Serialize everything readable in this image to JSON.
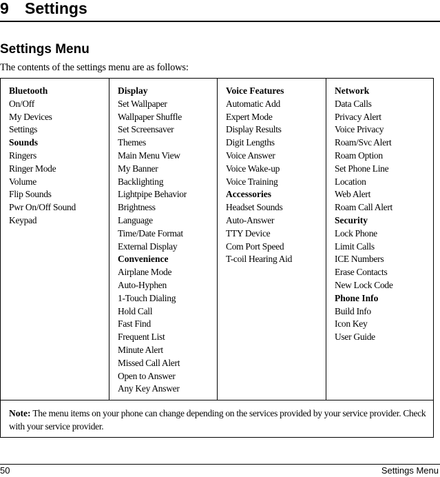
{
  "chapter": {
    "number": "9",
    "title": "Settings"
  },
  "section": {
    "title": "Settings Menu",
    "intro": "The contents of the settings menu are as follows:"
  },
  "menu_table": {
    "columns": [
      [
        {
          "text": "Bluetooth",
          "heading": true
        },
        {
          "text": "On/Off",
          "heading": false
        },
        {
          "text": "My Devices",
          "heading": false
        },
        {
          "text": "Settings",
          "heading": false
        },
        {
          "text": "Sounds",
          "heading": true
        },
        {
          "text": "Ringers",
          "heading": false
        },
        {
          "text": "Ringer Mode",
          "heading": false
        },
        {
          "text": "Volume",
          "heading": false
        },
        {
          "text": "Flip Sounds",
          "heading": false
        },
        {
          "text": "Pwr On/Off Sound",
          "heading": false
        },
        {
          "text": "Keypad",
          "heading": false
        }
      ],
      [
        {
          "text": "Display",
          "heading": true
        },
        {
          "text": "Set Wallpaper",
          "heading": false
        },
        {
          "text": "Wallpaper Shuffle",
          "heading": false
        },
        {
          "text": "Set Screensaver",
          "heading": false
        },
        {
          "text": "Themes",
          "heading": false
        },
        {
          "text": "Main Menu View",
          "heading": false
        },
        {
          "text": "My Banner",
          "heading": false
        },
        {
          "text": "Backlighting",
          "heading": false
        },
        {
          "text": "Lightpipe Behavior",
          "heading": false
        },
        {
          "text": "Brightness",
          "heading": false
        },
        {
          "text": "Language",
          "heading": false
        },
        {
          "text": "Time/Date Format",
          "heading": false
        },
        {
          "text": "External Display",
          "heading": false
        },
        {
          "text": "Convenience",
          "heading": true
        },
        {
          "text": "Airplane Mode",
          "heading": false
        },
        {
          "text": "Auto-Hyphen",
          "heading": false
        },
        {
          "text": "1-Touch Dialing",
          "heading": false
        },
        {
          "text": "Hold Call",
          "heading": false
        },
        {
          "text": "Fast Find",
          "heading": false
        },
        {
          "text": "Frequent List",
          "heading": false
        },
        {
          "text": "Minute Alert",
          "heading": false
        },
        {
          "text": "Missed Call Alert",
          "heading": false
        },
        {
          "text": "Open to Answer",
          "heading": false
        },
        {
          "text": "Any Key Answer",
          "heading": false
        }
      ],
      [
        {
          "text": "Voice Features",
          "heading": true
        },
        {
          "text": "Automatic Add",
          "heading": false
        },
        {
          "text": "Expert Mode",
          "heading": false
        },
        {
          "text": "Display Results",
          "heading": false
        },
        {
          "text": "Digit Lengths",
          "heading": false
        },
        {
          "text": "Voice Answer",
          "heading": false
        },
        {
          "text": "Voice Wake-up",
          "heading": false
        },
        {
          "text": "Voice Training",
          "heading": false
        },
        {
          "text": "Accessories",
          "heading": true
        },
        {
          "text": "Headset Sounds",
          "heading": false
        },
        {
          "text": "Auto-Answer",
          "heading": false
        },
        {
          "text": "TTY Device",
          "heading": false
        },
        {
          "text": "Com Port Speed",
          "heading": false
        },
        {
          "text": "T-coil Hearing Aid",
          "heading": false
        }
      ],
      [
        {
          "text": "Network",
          "heading": true
        },
        {
          "text": "Data Calls",
          "heading": false
        },
        {
          "text": "Privacy Alert",
          "heading": false
        },
        {
          "text": "Voice Privacy",
          "heading": false
        },
        {
          "text": "Roam/Svc Alert",
          "heading": false
        },
        {
          "text": "Roam Option",
          "heading": false
        },
        {
          "text": "Set Phone Line",
          "heading": false
        },
        {
          "text": "Location",
          "heading": false
        },
        {
          "text": "Web Alert",
          "heading": false
        },
        {
          "text": "Roam Call Alert",
          "heading": false
        },
        {
          "text": "Security",
          "heading": true
        },
        {
          "text": "Lock Phone",
          "heading": false
        },
        {
          "text": "Limit Calls",
          "heading": false
        },
        {
          "text": "ICE Numbers",
          "heading": false
        },
        {
          "text": "Erase Contacts",
          "heading": false
        },
        {
          "text": "New Lock Code",
          "heading": false
        },
        {
          "text": "Phone Info",
          "heading": true
        },
        {
          "text": "Build Info",
          "heading": false
        },
        {
          "text": "Icon Key",
          "heading": false
        },
        {
          "text": "User Guide",
          "heading": false
        }
      ]
    ],
    "note": {
      "label": "Note:",
      "text": " The menu items on your phone can change depending on the services provided by your service provider. Check with your service provider."
    }
  },
  "footer": {
    "page_number": "50",
    "section_name": "Settings Menu"
  }
}
